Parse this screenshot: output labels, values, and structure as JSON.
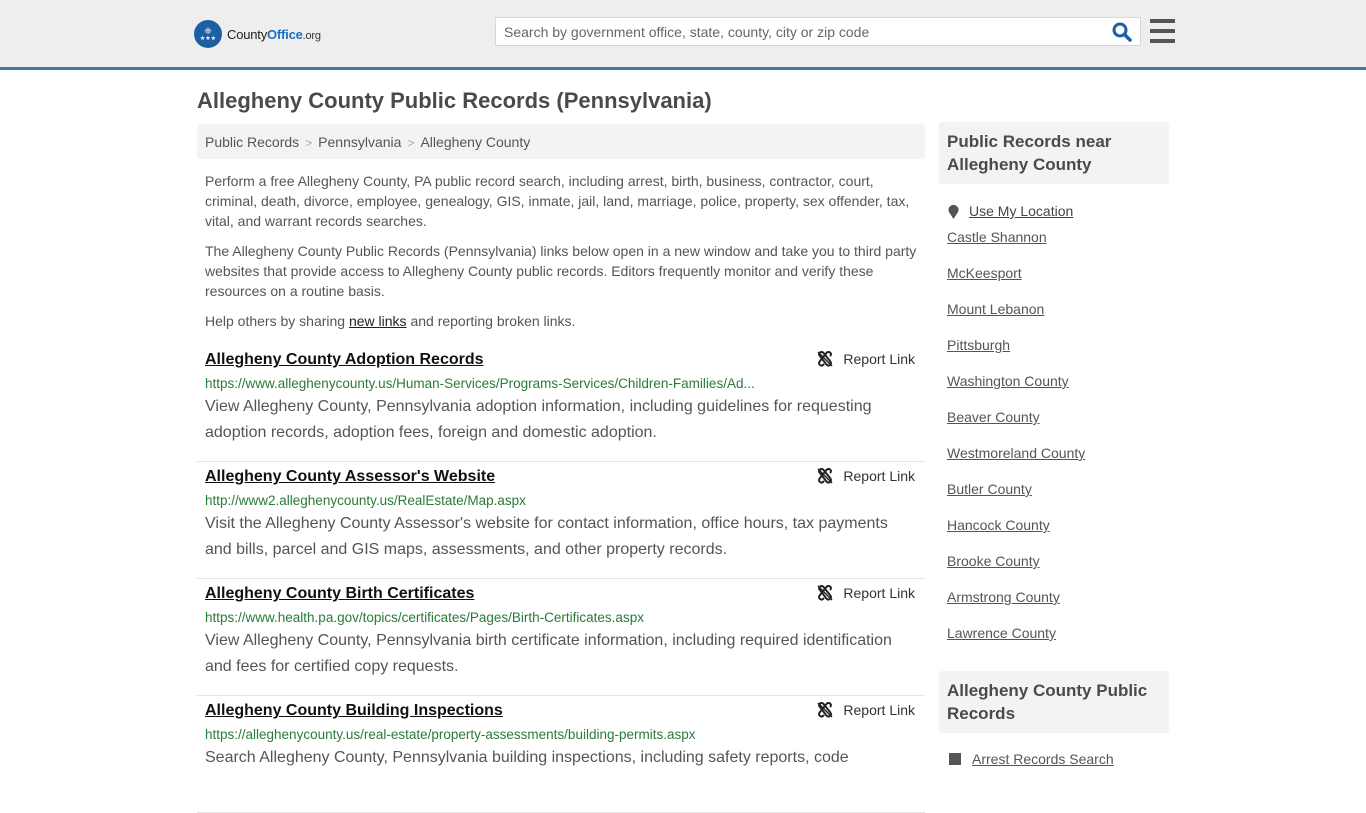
{
  "header": {
    "logo": {
      "county": "County",
      "office": "Office",
      "org": ".org"
    },
    "search_placeholder": "Search by government office, state, county, city or zip code",
    "search_value": ""
  },
  "page_title": "Allegheny County Public Records (Pennsylvania)",
  "breadcrumb": [
    {
      "label": "Public Records"
    },
    {
      "label": "Pennsylvania"
    },
    {
      "label": "Allegheny County"
    }
  ],
  "intro": {
    "p1": "Perform a free Allegheny County, PA public record search, including arrest, birth, business, contractor, court, criminal, death, divorce, employee, genealogy, GIS, inmate, jail, land, marriage, police, property, sex offender, tax, vital, and warrant records searches.",
    "p2": "The Allegheny County Public Records (Pennsylvania) links below open in a new window and take you to third party websites that provide access to Allegheny County public records. Editors frequently monitor and verify these resources on a routine basis.",
    "p3_before": "Help others by sharing ",
    "p3_link": "new links",
    "p3_after": " and reporting broken links."
  },
  "report_link_label": "Report Link",
  "records": [
    {
      "title": "Allegheny County Adoption Records",
      "url": "https://www.alleghenycounty.us/Human-Services/Programs-Services/Children-Families/Ad...",
      "description": "View Allegheny County, Pennsylvania adoption information, including guidelines for requesting adoption records, adoption fees, foreign and domestic adoption."
    },
    {
      "title": "Allegheny County Assessor's Website",
      "url": "http://www2.alleghenycounty.us/RealEstate/Map.aspx",
      "description": "Visit the Allegheny County Assessor's website for contact information, office hours, tax payments and bills, parcel and GIS maps, assessments, and other property records."
    },
    {
      "title": "Allegheny County Birth Certificates",
      "url": "https://www.health.pa.gov/topics/certificates/Pages/Birth-Certificates.aspx",
      "description": "View Allegheny County, Pennsylvania birth certificate information, including required identification and fees for certified copy requests."
    },
    {
      "title": "Allegheny County Building Inspections",
      "url": "https://alleghenycounty.us/real-estate/property-assessments/building-permits.aspx",
      "description": "Search Allegheny County, Pennsylvania building inspections, including safety reports, code"
    }
  ],
  "sidebar": {
    "near_heading": "Public Records near Allegheny County",
    "use_location": "Use My Location",
    "near_links": [
      "Castle Shannon",
      "McKeesport",
      "Mount Lebanon",
      "Pittsburgh",
      "Washington County",
      "Beaver County",
      "Westmoreland County",
      "Butler County",
      "Hancock County",
      "Brooke County",
      "Armstrong County",
      "Lawrence County"
    ],
    "records_heading": "Allegheny County Public Records",
    "records_links": [
      "Arrest Records Search"
    ]
  },
  "colors": {
    "header_bg": "#eeeeee",
    "header_border": "#3a7aaa",
    "brand_blue": "#1d5fa3",
    "url_green": "#2a7a3a",
    "panel_bg": "#f3f3f3"
  }
}
